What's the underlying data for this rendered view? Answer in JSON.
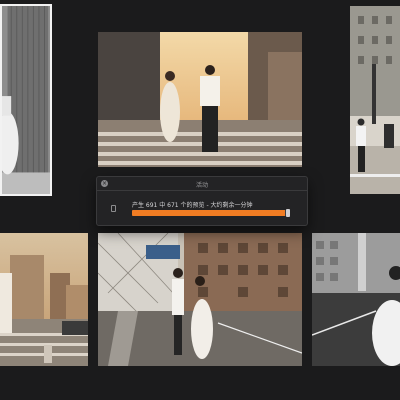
{
  "dialog": {
    "title": "活动",
    "close_label": "×",
    "progress_text": "产生 691 中 671 个的预览 - 大约剩余一分钟",
    "progress": {
      "done": 671,
      "total": 691
    },
    "accent_color": "#f07c23"
  },
  "thumbnails": [
    {
      "label": "Photo thumbnail 1 (selected)"
    },
    {
      "label": "Photo thumbnail 2"
    },
    {
      "label": "Photo thumbnail 3"
    },
    {
      "label": "Photo thumbnail 4"
    },
    {
      "label": "Photo thumbnail 5"
    },
    {
      "label": "Photo thumbnail 6"
    }
  ]
}
